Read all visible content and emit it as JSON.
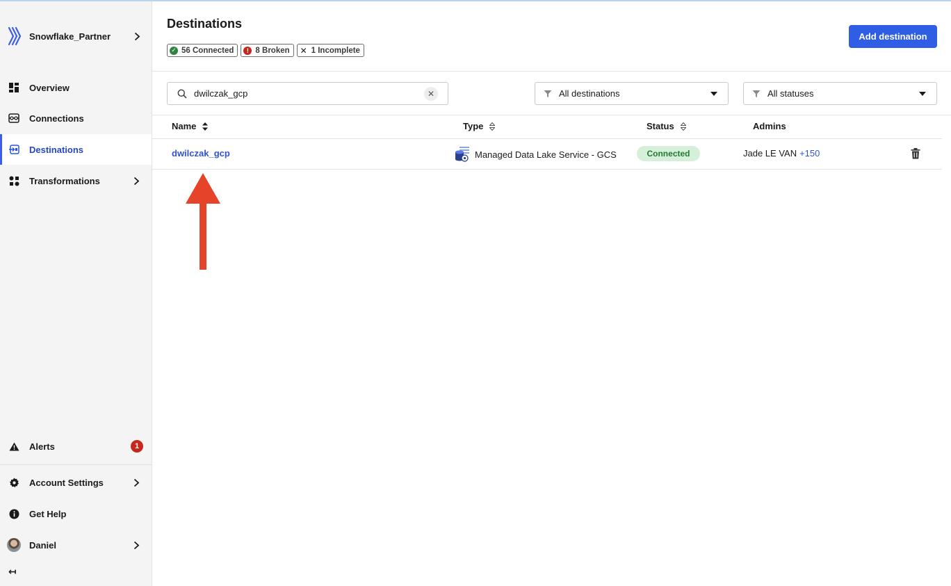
{
  "sidebar": {
    "org_name": "Snowflake_Partner",
    "nav": {
      "overview": "Overview",
      "connections": "Connections",
      "destinations": "Destinations",
      "transformations": "Transformations"
    },
    "alerts": {
      "label": "Alerts",
      "count": "1"
    },
    "account_settings": "Account Settings",
    "get_help": "Get Help",
    "user": "Daniel",
    "collapse_glyph": "↤"
  },
  "header": {
    "title": "Destinations",
    "summary": {
      "connected": "56 Connected",
      "broken": "8 Broken",
      "incomplete": "1 Incomplete"
    },
    "add_button": "Add destination"
  },
  "filters": {
    "search_value": "dwilczak_gcp",
    "destination_filter": "All destinations",
    "status_filter": "All statuses"
  },
  "table": {
    "columns": {
      "name": "Name",
      "type": "Type",
      "status": "Status",
      "admins": "Admins"
    },
    "rows": [
      {
        "name": "dwilczak_gcp",
        "type": "Managed Data Lake Service - GCS",
        "status": "Connected",
        "admin": "Jade LE VAN",
        "admins_more": "+150"
      }
    ]
  },
  "colors": {
    "accent": "#2f5de4",
    "link": "#2f52d6",
    "status_connected_bg": "#d6efd8",
    "status_connected_text": "#1f7a32",
    "broken": "#c5281c",
    "annotation_arrow": "#e5432a"
  },
  "icons": {
    "logo": "brand-logo-icon",
    "search": "search-icon",
    "filter": "filter-icon",
    "trash": "trash-icon",
    "type": "database-gcs-icon"
  }
}
